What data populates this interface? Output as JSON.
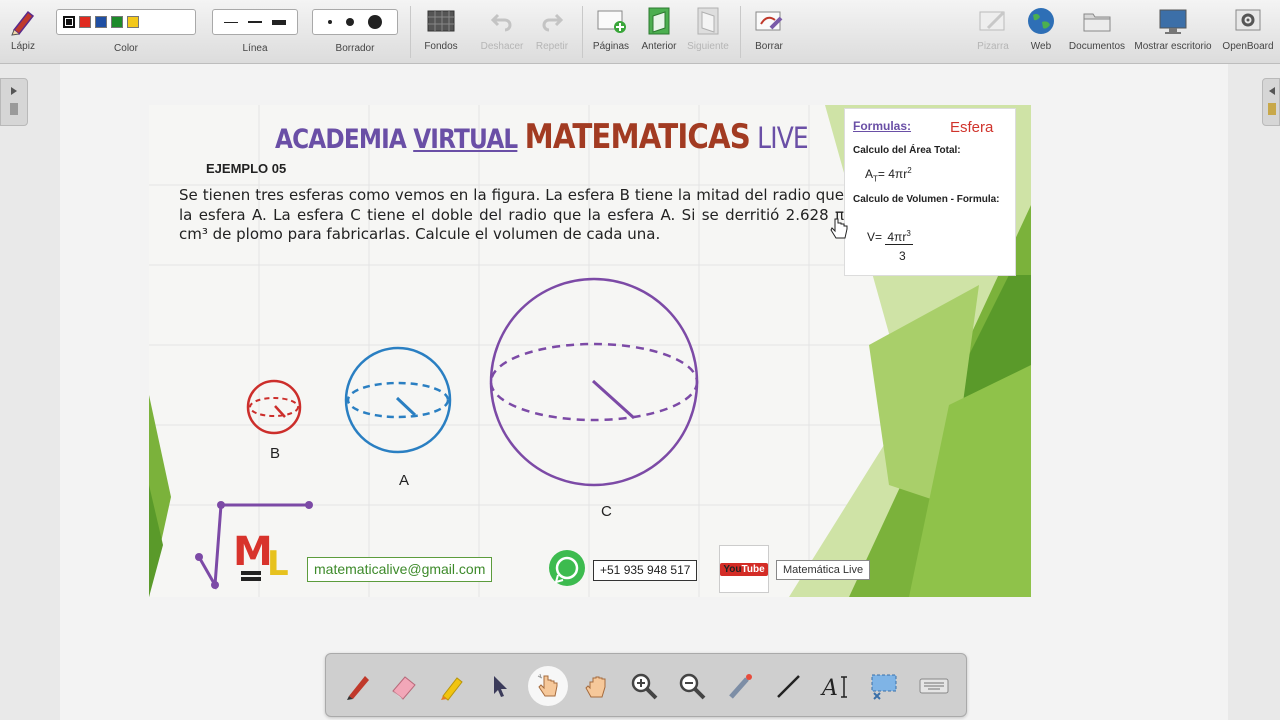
{
  "toolbar": {
    "lapiz": "Lápiz",
    "color": "Color",
    "linea": "Línea",
    "borrador": "Borrador",
    "fondos": "Fondos",
    "deshacer": "Deshacer",
    "repetir": "Repetir",
    "paginas": "Páginas",
    "anterior": "Anterior",
    "siguiente": "Siguiente",
    "borrar": "Borrar",
    "pizarra": "Pizarra",
    "web": "Web",
    "documentos": "Documentos",
    "mostrar_escritorio": "Mostrar escritorio",
    "openboard": "OpenBoard"
  },
  "colors": {
    "swatches": [
      "#111111",
      "#e02b20",
      "#1f4fa3",
      "#1d8a2a",
      "#f3c81b"
    ],
    "purple": "#6a4fa6",
    "red_sphere": "#cc2e2b",
    "blue_sphere": "#2a7fc2",
    "violet_sphere": "#7c4aa6",
    "green": "#7bb23b"
  },
  "slide": {
    "title_academia": "ACADEMIA",
    "title_virtual": "VIRTUAL",
    "title_math": "MATEMATICAS",
    "title_live": "LIVE",
    "ejemplo": "EJEMPLO 05",
    "problem": "Se tienen tres esferas como vemos en la figura. La esfera B  tiene la mitad del radio que la esfera A. La esfera C tiene el doble del radio que la esfera A. Si se derritió 2.628 π cm³ de plomo para fabricarlas. Calcule el volumen de cada una.",
    "formulas": {
      "title": "Formulas:",
      "esfera": "Esfera",
      "area_title": "Calculo del Área Total:",
      "area_lhs": "A",
      "area_sub": "T",
      "area_rhs": "= 4πr",
      "area_exp": "2",
      "vol_title": "Calculo de Volumen - Formula:",
      "vol_lhs": "V=",
      "vol_num": "4πr",
      "vol_exp": "3",
      "vol_den": "3"
    },
    "labels": {
      "b": "B",
      "a": "A",
      "c": "C"
    },
    "logo_text": "ML",
    "email": "matematicalive@gmail.com",
    "phone": "+51 935 948 517",
    "youtube_you": "You",
    "youtube_tube": "Tube",
    "channel": "Matemática Live"
  }
}
